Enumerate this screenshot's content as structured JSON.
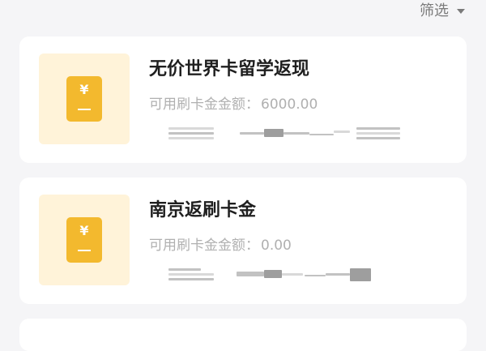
{
  "filter": {
    "label": "筛选",
    "caret_icon": "caret-down-icon"
  },
  "cards": [
    {
      "title": "无价世界卡留学返现",
      "amount_label": "可用刷卡金金额：",
      "amount_value": "6000.00",
      "icon": "yen-card-icon"
    },
    {
      "title": "南京返刷卡金",
      "amount_label": "可用刷卡金金额：",
      "amount_value": "0.00",
      "icon": "yen-card-icon"
    }
  ],
  "colors": {
    "page_background": "#f5f5f7",
    "card_background": "#ffffff",
    "thumb_background": "#fff3d9",
    "coin": "#f3b92e",
    "title": "#1f1f1f",
    "muted": "#b0b0b0"
  }
}
